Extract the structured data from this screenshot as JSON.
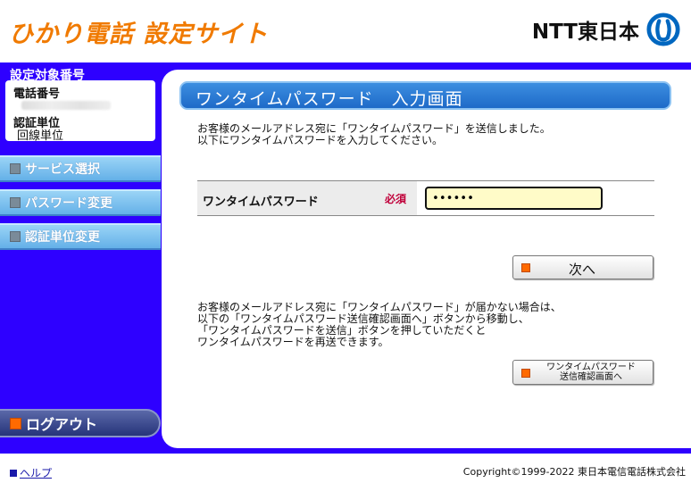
{
  "header": {
    "site_title": "ひかり電話 設定サイト",
    "logo_text": "NTT東日本"
  },
  "sidebar": {
    "target_label": "設定対象番号",
    "phone_label": "電話番号",
    "auth_label": "認証単位",
    "auth_value": "回線単位",
    "items": [
      {
        "label": "サービス選択"
      },
      {
        "label": "パスワード変更"
      },
      {
        "label": "認証単位変更"
      }
    ],
    "logout_label": "ログアウト"
  },
  "main": {
    "heading": "ワンタイムパスワード　入力画面",
    "intro_line1": "お客様のメールアドレス宛に「ワンタイムパスワード」を送信しました。",
    "intro_line2": "以下にワンタイムパスワードを入力してください。",
    "field_label": "ワンタイムパスワード",
    "required_label": "必須",
    "password_value": "••••••",
    "next_label": "次へ",
    "note_line1": "お客様のメールアドレス宛に「ワンタイムパスワード」が届かない場合は、",
    "note_line2": "以下の「ワンタイムパスワード送信確認画面へ」ボタンから移動し、",
    "note_line3": "「ワンタイムパスワードを送信」ボタンを押していただくと",
    "note_line4": "ワンタイムパスワードを再送できます。",
    "resend_line1": "ワンタイムパスワード",
    "resend_line2": "送信確認画面へ"
  },
  "footer": {
    "help_label": "ヘルプ",
    "copyright": "Copyright©1999-2022 東日本電信電話株式会社"
  },
  "colors": {
    "brand_orange": "#f07a00",
    "frame_blue": "#2e00ff",
    "heading_blue": "#1e6ac8",
    "required_red": "#c0003a",
    "input_yellow": "#fffbc8"
  }
}
